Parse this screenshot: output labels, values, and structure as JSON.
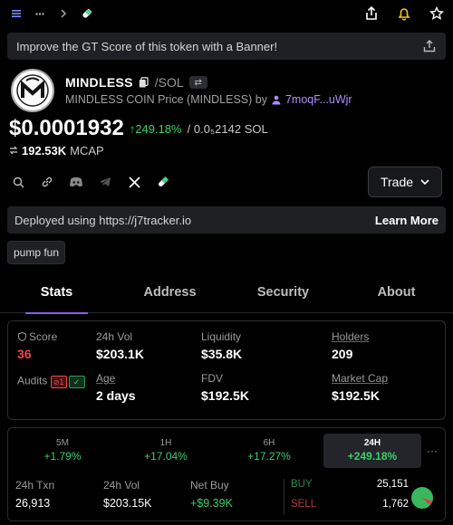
{
  "banner": {
    "text": "Improve the GT Score of this token with a Banner!"
  },
  "token": {
    "symbol": "MINDLESS",
    "pair": "/SOL",
    "subtitle": "MINDLESS COIN Price (MINDLESS) by",
    "creator": "7moqF...uWjr"
  },
  "price": {
    "usd": "$0.0001932",
    "change": "↑249.18%",
    "sol": "/ 0.0₅2142 SOL",
    "mcap_value": "192.53K",
    "mcap_label": "MCAP"
  },
  "trade": {
    "label": "Trade"
  },
  "deployed": {
    "text": "Deployed using https://j7tracker.io",
    "link": "Learn More"
  },
  "tag": {
    "label": "pump fun"
  },
  "tabs": [
    "Stats",
    "Address",
    "Security",
    "About"
  ],
  "stats": {
    "score_label": "Score",
    "score_value": "36",
    "vol_label": "24h Vol",
    "vol_value": "$203.1K",
    "liq_label": "Liquidity",
    "liq_value": "$35.8K",
    "holders_label": "Holders",
    "holders_value": "209",
    "audits_label": "Audits",
    "audits_bad": "1",
    "age_label": "Age",
    "age_value": "2 days",
    "fdv_label": "FDV",
    "fdv_value": "$192.5K",
    "mcap_label": "Market Cap",
    "mcap_value": "$192.5K"
  },
  "timeframes": [
    {
      "label": "5M",
      "pct": "+1.79%"
    },
    {
      "label": "1H",
      "pct": "+17.04%"
    },
    {
      "label": "6H",
      "pct": "+17.27%"
    },
    {
      "label": "24H",
      "pct": "+249.18%"
    }
  ],
  "more": "···",
  "daily": {
    "txn_label": "24h Txn",
    "txn_value": "26,913",
    "vol_label": "24h Vol",
    "vol_value": "$203.15K",
    "netbuy_label": "Net Buy",
    "netbuy_value": "+$9.39K",
    "buy_label": "BUY",
    "buy_value": "25,151",
    "sell_label": "SELL",
    "sell_value": "1,762",
    "buy_share": 0.935
  },
  "colors": {
    "accent": "#8b5cf6",
    "up": "#39d06b",
    "down": "#f24545"
  }
}
